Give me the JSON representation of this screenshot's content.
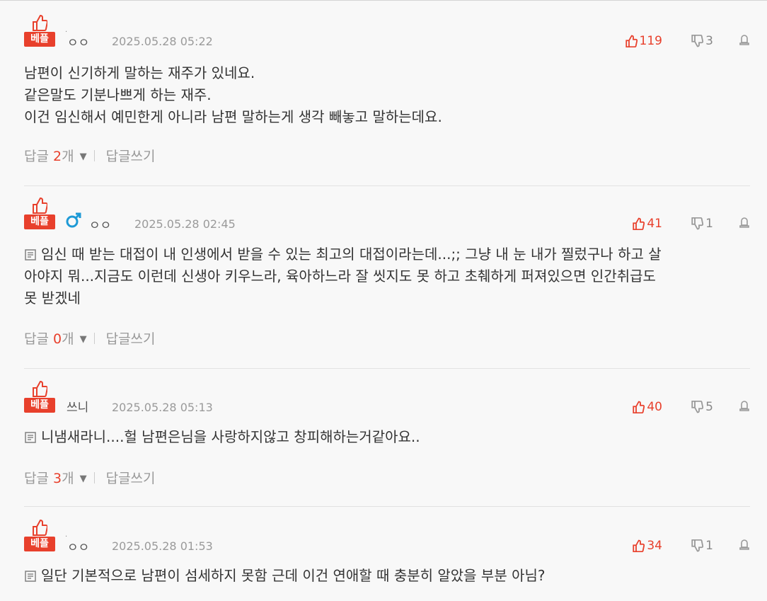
{
  "badge_label": "베플",
  "comments": [
    {
      "author": "ㅇㅇ",
      "date": "2025.05.28 05:22",
      "up": "119",
      "down": "3",
      "lines": [
        "남편이 신기하게 말하는 재주가 있네요.",
        "같은말도 기분나쁘게 하는 재주.",
        "이건 임신해서 예민한게 아니라 남편 말하는게 생각 빼놓고 말하는데요."
      ],
      "reply_label": "답글",
      "reply_count": "2",
      "reply_unit": "개",
      "write_label": "답글쓰기"
    },
    {
      "author": "ㅇㅇ",
      "date": "2025.05.28 02:45",
      "up": "41",
      "down": "1",
      "lines": [
        "임신 때 받는 대접이 내 인생에서 받을 수 있는 최고의 대접이라는데...;; 그냥 내 눈 내가 찔렀구나 하고 살",
        "아야지 뭐...지금도 이런데 신생아 키우느라, 육아하느라 잘 씻지도 못 하고 초췌하게 퍼져있으면 인간취급도",
        "못 받겠네"
      ],
      "reply_label": "답글",
      "reply_count": "0",
      "reply_unit": "개",
      "write_label": "답글쓰기"
    },
    {
      "author": "쓰니",
      "date": "2025.05.28 05:13",
      "up": "40",
      "down": "5",
      "lines": [
        "니냄새라니....헐 남편은님을 사랑하지않고 창피해하는거같아요.."
      ],
      "reply_label": "답글",
      "reply_count": "3",
      "reply_unit": "개",
      "write_label": "답글쓰기"
    },
    {
      "author": "ㅇㅇ",
      "date": "2025.05.28 01:53",
      "up": "34",
      "down": "1",
      "lines": [
        "일단 기본적으로 남편이 섬세하지 못함 근데 이건 연애할 때 충분히 알았을 부분 아님?"
      ]
    }
  ],
  "colors": {
    "accent": "#e8402c",
    "gender": "#1e9ad6"
  },
  "icons": {
    "best": "thumbs-up-icon",
    "up": "thumbs-up-icon",
    "down": "thumbs-down-icon",
    "report": "report-icon",
    "memo": "memo-icon",
    "gender": "male-icon"
  }
}
